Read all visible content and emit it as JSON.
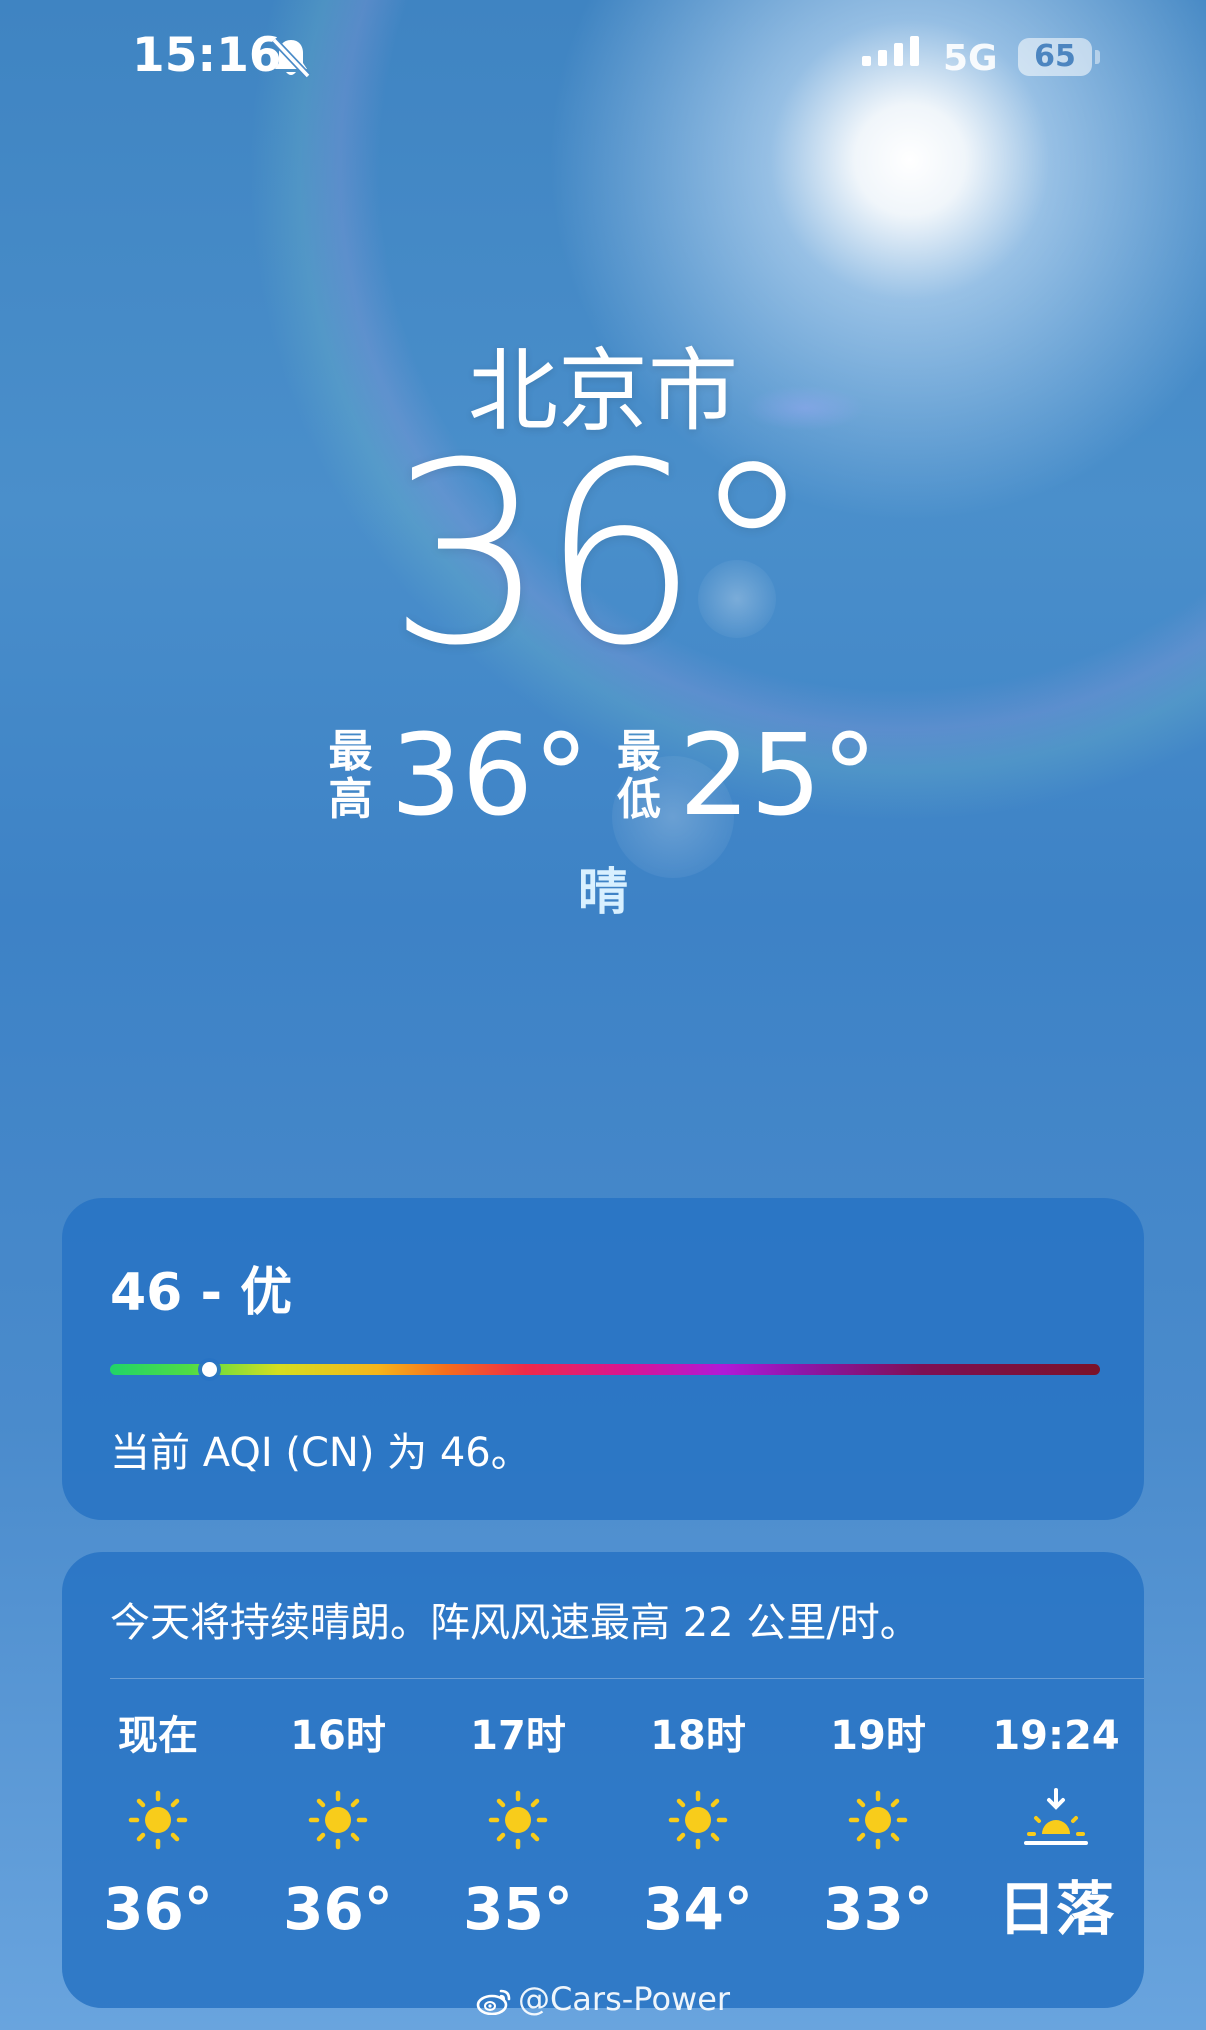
{
  "status_bar": {
    "time": "15:16",
    "network": "5G",
    "battery": "65",
    "icons": [
      "bell-slash-icon",
      "signal-icon",
      "battery-icon"
    ]
  },
  "location": {
    "city": "北京市"
  },
  "current": {
    "temperature": "36",
    "degree_symbol": "°",
    "high_label_1": "最",
    "high_label_2": "高",
    "high": "36°",
    "low_label_1": "最",
    "low_label_2": "低",
    "low": "25°",
    "condition": "晴"
  },
  "aqi": {
    "title": "46 - 优",
    "value": 46,
    "level_fraction": 0.1,
    "description": "当前 AQI (CN) 为 46。",
    "gradient_colors": [
      "#21d468",
      "#d4de21",
      "#f56d1c",
      "#ee2a4a",
      "#d81592",
      "#b01ad7",
      "#7a1229"
    ]
  },
  "forecast": {
    "summary": "今天将持续晴朗。阵风风速最高 22 公里/时。",
    "hours": [
      {
        "label": "现在",
        "icon": "sun-icon",
        "temp": "36°"
      },
      {
        "label": "16时",
        "icon": "sun-icon",
        "temp": "36°"
      },
      {
        "label": "17时",
        "icon": "sun-icon",
        "temp": "35°"
      },
      {
        "label": "18时",
        "icon": "sun-icon",
        "temp": "34°"
      },
      {
        "label": "19时",
        "icon": "sun-icon",
        "temp": "33°"
      },
      {
        "label": "19:24",
        "icon": "sunset-icon",
        "temp": "日落"
      }
    ]
  },
  "watermark": {
    "text": "@Cars-Power",
    "icon": "weibo-icon"
  },
  "colors": {
    "sun_icon": "#f8cc1b",
    "card_background": "#2873c4",
    "condition_text": "#d8f0ff"
  }
}
